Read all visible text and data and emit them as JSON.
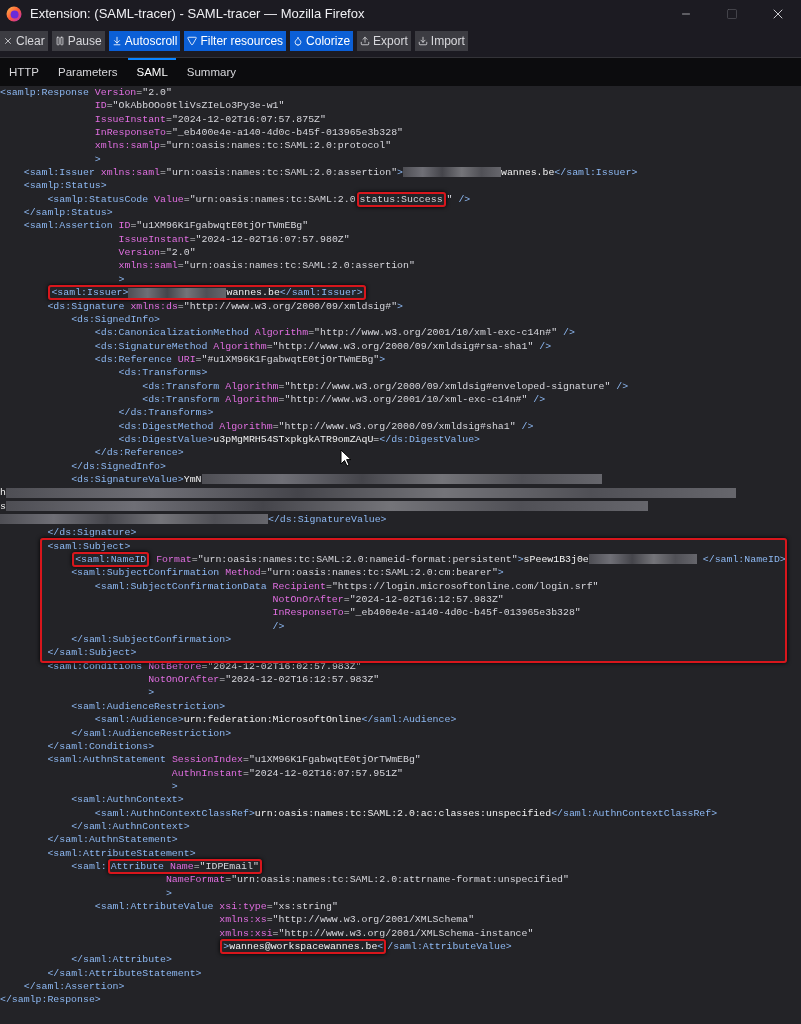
{
  "window": {
    "title": "Extension: (SAML-tracer) - SAML-tracer — Mozilla Firefox",
    "controls": [
      {
        "kind": "minimize",
        "disabled": false
      },
      {
        "kind": "maximize",
        "disabled": true
      },
      {
        "kind": "close",
        "disabled": false
      }
    ]
  },
  "toolbar": [
    {
      "kind": "clear",
      "label": "Clear",
      "on": false
    },
    {
      "kind": "pause",
      "label": "Pause",
      "on": false
    },
    {
      "kind": "autoscroll",
      "label": "Autoscroll",
      "on": true
    },
    {
      "kind": "filter",
      "label": "Filter resources",
      "on": true
    },
    {
      "kind": "colorize",
      "label": "Colorize",
      "on": true
    },
    {
      "kind": "export",
      "label": "Export",
      "on": false
    },
    {
      "kind": "import",
      "label": "Import",
      "on": false
    }
  ],
  "tabs": [
    {
      "label": "HTTP",
      "selected": false
    },
    {
      "label": "Parameters",
      "selected": false
    },
    {
      "label": "SAML",
      "selected": true
    },
    {
      "label": "Summary",
      "selected": false
    }
  ],
  "code": {
    "lines": [
      {
        "kind": "element",
        "tokens": [
          {
            "kind": "tag",
            "text": "<samlp:Response"
          },
          {
            "kind": "attr",
            "text": " Version"
          },
          {
            "kind": "value",
            "text": "=\"2.0\""
          }
        ],
        "continuation_lines": [
          {
            "tokens": [
              {
                "kind": "attr",
                "text": "ID"
              },
              {
                "kind": "value",
                "text": "=\"OkAbbOOo9tliVsZIeLo3Py3e-w1\""
              }
            ]
          },
          {
            "tokens": [
              {
                "kind": "attr",
                "text": "IssueInstant"
              },
              {
                "kind": "value",
                "text": "=\"2024-12-02T16:07:57.875Z\""
              }
            ]
          },
          {
            "tokens": [
              {
                "kind": "attr",
                "text": "InResponseTo"
              },
              {
                "kind": "value",
                "text": "=\"_eb400e4e-a140-4d0c-b45f-013965e3b328\""
              }
            ]
          },
          {
            "tokens": [
              {
                "kind": "attr",
                "text": "xmlns:samlp"
              },
              {
                "kind": "value",
                "text": "=\"urn:oasis:names:tc:SAML:2.0:protocol\""
              }
            ]
          },
          {
            "tokens": [
              {
                "kind": "tag",
                "text": ">"
              }
            ]
          }
        ],
        "children": [
          {
            "kind": "element",
            "tokens": [
              {
                "kind": "tag",
                "text": "<saml:Issuer"
              },
              {
                "kind": "attr",
                "text": " xmlns:saml"
              },
              {
                "kind": "value",
                "text": "=\"urn:oasis:names:tc:SAML:2.0:assertion\""
              },
              {
                "kind": "tag",
                "text": ">"
              },
              {
                "kind": "redacted-short"
              },
              {
                "kind": "text",
                "text": "wannes.be"
              },
              {
                "kind": "tag",
                "text": "</saml:Issuer>"
              }
            ]
          },
          {
            "kind": "element",
            "tokens": [
              {
                "kind": "tag",
                "text": "<samlp:Status>"
              }
            ],
            "children": [
              {
                "kind": "element",
                "tokens": [
                  {
                    "kind": "tag",
                    "text": "<samlp:StatusCode"
                  },
                  {
                    "kind": "attr",
                    "text": " Value"
                  },
                  {
                    "kind": "value",
                    "text": "=\"urn:oasis:names:tc:SAML:2.0"
                  },
                  {
                    "kind": "boxed",
                    "tokens": [
                      {
                        "kind": "value",
                        "text": "status:Success"
                      }
                    ]
                  },
                  {
                    "kind": "value",
                    "text": "\""
                  },
                  {
                    "kind": "tag",
                    "text": " />"
                  }
                ]
              }
            ]
          },
          {
            "kind": "element",
            "tokens": [
              {
                "kind": "tag",
                "text": "</samlp:Status>"
              }
            ]
          },
          {
            "kind": "element",
            "tokens": [
              {
                "kind": "tag",
                "text": "<saml:Assertion"
              },
              {
                "kind": "attr",
                "text": " ID"
              },
              {
                "kind": "value",
                "text": "=\"u1XM96K1FgabwqtE0tjOrTWmEBg\""
              }
            ],
            "continuation_lines": [
              {
                "tokens": [
                  {
                    "kind": "attr",
                    "text": "IssueInstant"
                  },
                  {
                    "kind": "value",
                    "text": "=\"2024-12-02T16:07:57.980Z\""
                  }
                ]
              },
              {
                "tokens": [
                  {
                    "kind": "attr",
                    "text": "Version"
                  },
                  {
                    "kind": "value",
                    "text": "=\"2.0\""
                  }
                ]
              },
              {
                "tokens": [
                  {
                    "kind": "attr",
                    "text": "xmlns:saml"
                  },
                  {
                    "kind": "value",
                    "text": "=\"urn:oasis:names:tc:SAML:2.0:assertion\""
                  }
                ]
              },
              {
                "tokens": [
                  {
                    "kind": "tag",
                    "text": ">"
                  }
                ]
              }
            ],
            "children": [
              {
                "kind": "element",
                "tokens": [
                  {
                    "kind": "boxed",
                    "tokens": [
                      {
                        "kind": "tag",
                        "text": "<saml:Issuer>"
                      },
                      {
                        "kind": "redacted-short"
                      },
                      {
                        "kind": "text",
                        "text": "wannes.be"
                      },
                      {
                        "kind": "tag",
                        "text": "</saml:Issuer>"
                      }
                    ]
                  }
                ]
              },
              {
                "kind": "element",
                "tokens": [
                  {
                    "kind": "tag",
                    "text": "<ds:Signature"
                  },
                  {
                    "kind": "attr",
                    "text": " xmlns:ds"
                  },
                  {
                    "kind": "value",
                    "text": "=\"http://www.w3.org/2000/09/xmldsig#\""
                  },
                  {
                    "kind": "tag",
                    "text": ">"
                  }
                ],
                "children": [
                  {
                    "kind": "element",
                    "tokens": [
                      {
                        "kind": "tag",
                        "text": "<ds:SignedInfo>"
                      }
                    ],
                    "children": [
                      {
                        "kind": "element",
                        "tokens": [
                          {
                            "kind": "tag",
                            "text": "<ds:CanonicalizationMethod"
                          },
                          {
                            "kind": "attr",
                            "text": " Algorithm"
                          },
                          {
                            "kind": "value",
                            "text": "=\"http://www.w3.org/2001/10/xml-exc-c14n#\""
                          },
                          {
                            "kind": "tag",
                            "text": " />"
                          }
                        ]
                      },
                      {
                        "kind": "element",
                        "tokens": [
                          {
                            "kind": "tag",
                            "text": "<ds:SignatureMethod"
                          },
                          {
                            "kind": "attr",
                            "text": " Algorithm"
                          },
                          {
                            "kind": "value",
                            "text": "=\"http://www.w3.org/2000/09/xmldsig#rsa-sha1\""
                          },
                          {
                            "kind": "tag",
                            "text": " />"
                          }
                        ]
                      },
                      {
                        "kind": "element",
                        "tokens": [
                          {
                            "kind": "tag",
                            "text": "<ds:Reference"
                          },
                          {
                            "kind": "attr",
                            "text": " URI"
                          },
                          {
                            "kind": "value",
                            "text": "=\"#u1XM96K1FgabwqtE0tjOrTWmEBg\""
                          },
                          {
                            "kind": "tag",
                            "text": ">"
                          }
                        ],
                        "children": [
                          {
                            "kind": "element",
                            "tokens": [
                              {
                                "kind": "tag",
                                "text": "<ds:Transforms>"
                              }
                            ],
                            "children": [
                              {
                                "kind": "element",
                                "tokens": [
                                  {
                                    "kind": "tag",
                                    "text": "<ds:Transform"
                                  },
                                  {
                                    "kind": "attr",
                                    "text": " Algorithm"
                                  },
                                  {
                                    "kind": "value",
                                    "text": "=\"http://www.w3.org/2000/09/xmldsig#enveloped-signature\""
                                  },
                                  {
                                    "kind": "tag",
                                    "text": " />"
                                  }
                                ]
                              },
                              {
                                "kind": "element",
                                "tokens": [
                                  {
                                    "kind": "tag",
                                    "text": "<ds:Transform"
                                  },
                                  {
                                    "kind": "attr",
                                    "text": " Algorithm"
                                  },
                                  {
                                    "kind": "value",
                                    "text": "=\"http://www.w3.org/2001/10/xml-exc-c14n#\""
                                  },
                                  {
                                    "kind": "tag",
                                    "text": " />"
                                  }
                                ]
                              }
                            ]
                          },
                          {
                            "kind": "element",
                            "tokens": [
                              {
                                "kind": "tag",
                                "text": "</ds:Transforms>"
                              }
                            ]
                          },
                          {
                            "kind": "element",
                            "tokens": [
                              {
                                "kind": "tag",
                                "text": "<ds:DigestMethod"
                              },
                              {
                                "kind": "attr",
                                "text": " Algorithm"
                              },
                              {
                                "kind": "value",
                                "text": "=\"http://www.w3.org/2000/09/xmldsig#sha1\""
                              },
                              {
                                "kind": "tag",
                                "text": " />"
                              }
                            ]
                          },
                          {
                            "kind": "element",
                            "tokens": [
                              {
                                "kind": "tag",
                                "text": "<ds:DigestValue>"
                              },
                              {
                                "kind": "text",
                                "text": "u3pMgMRH54STxpkgkATR9omZAqU="
                              },
                              {
                                "kind": "tag",
                                "text": "</ds:DigestValue>"
                              }
                            ]
                          }
                        ]
                      },
                      {
                        "kind": "element",
                        "tokens": [
                          {
                            "kind": "tag",
                            "text": "</ds:Reference>"
                          }
                        ]
                      }
                    ]
                  },
                  {
                    "kind": "element",
                    "tokens": [
                      {
                        "kind": "tag",
                        "text": "</ds:SignedInfo>"
                      }
                    ]
                  },
                  {
                    "kind": "element",
                    "tokens": [
                      {
                        "kind": "tag",
                        "text": "<ds:SignatureValue>"
                      },
                      {
                        "kind": "text",
                        "text": "YmN"
                      },
                      {
                        "kind": "redacted-wide"
                      }
                    ]
                  },
                  {
                    "kind": "wrapped",
                    "tokens": [
                      {
                        "kind": "text",
                        "text": "h"
                      },
                      {
                        "kind": "redacted-full"
                      }
                    ]
                  },
                  {
                    "kind": "wrapped",
                    "tokens": [
                      {
                        "kind": "text",
                        "text": "s"
                      },
                      {
                        "kind": "redacted-most"
                      }
                    ]
                  },
                  {
                    "kind": "wrapped",
                    "tokens": [
                      {
                        "kind": "redacted-long"
                      },
                      {
                        "kind": "tag",
                        "text": "</ds:SignatureValue>"
                      }
                    ]
                  }
                ]
              },
              {
                "kind": "element",
                "tokens": [
                  {
                    "kind": "tag",
                    "text": "</ds:Signature>"
                  }
                ]
              },
              {
                "kind": "boxed-block",
                "lines": [
                  {
                    "kind": "element",
                    "tokens": [
                      {
                        "kind": "tag",
                        "text": "<saml:Subject>"
                      }
                    ],
                    "children": [
                      {
                        "kind": "element",
                        "tokens": [
                          {
                            "kind": "boxed",
                            "tokens": [
                              {
                                "kind": "tag",
                                "text": "<saml:NameID"
                              }
                            ]
                          },
                          {
                            "kind": "attr",
                            "text": " Format"
                          },
                          {
                            "kind": "value",
                            "text": "=\"urn:oasis:names:tc:SAML:2.0:nameid-format:persistent\""
                          },
                          {
                            "kind": "tag",
                            "text": ">"
                          },
                          {
                            "kind": "text",
                            "text": "sPeew1B3j0e"
                          },
                          {
                            "kind": "redacted-medium"
                          },
                          {
                            "kind": "tag",
                            "text": "</saml:NameID>"
                          }
                        ]
                      },
                      {
                        "kind": "element",
                        "tokens": [
                          {
                            "kind": "tag",
                            "text": "<saml:SubjectConfirmation"
                          },
                          {
                            "kind": "attr",
                            "text": " Method"
                          },
                          {
                            "kind": "value",
                            "text": "=\"urn:oasis:names:tc:SAML:2.0:cm:bearer\""
                          },
                          {
                            "kind": "tag",
                            "text": ">"
                          }
                        ],
                        "children": [
                          {
                            "kind": "element",
                            "tokens": [
                              {
                                "kind": "tag",
                                "text": "<saml:SubjectConfirmationData"
                              },
                              {
                                "kind": "attr",
                                "text": " Recipient"
                              },
                              {
                                "kind": "value",
                                "text": "=\"https://login.microsoftonline.com/login.srf\""
                              }
                            ],
                            "continuation_lines": [
                              {
                                "tokens": [
                                  {
                                    "kind": "attr",
                                    "text": "NotOnOrAfter"
                                  },
                                  {
                                    "kind": "value",
                                    "text": "=\"2024-12-02T16:12:57.983Z\""
                                  }
                                ]
                              },
                              {
                                "tokens": [
                                  {
                                    "kind": "attr",
                                    "text": "InResponseTo"
                                  },
                                  {
                                    "kind": "value",
                                    "text": "=\"_eb400e4e-a140-4d0c-b45f-013965e3b328\""
                                  }
                                ]
                              },
                              {
                                "tokens": [
                                  {
                                    "kind": "tag",
                                    "text": "/>"
                                  }
                                ]
                              }
                            ]
                          }
                        ]
                      },
                      {
                        "kind": "element",
                        "tokens": [
                          {
                            "kind": "tag",
                            "text": "</saml:SubjectConfirmation>"
                          }
                        ]
                      }
                    ]
                  },
                  {
                    "kind": "element",
                    "tokens": [
                      {
                        "kind": "tag",
                        "text": "</saml:Subject>"
                      }
                    ]
                  }
                ]
              },
              {
                "kind": "element",
                "tokens": [
                  {
                    "kind": "tag",
                    "text": "<saml:Conditions"
                  },
                  {
                    "kind": "attr",
                    "text": " NotBefore"
                  },
                  {
                    "kind": "value",
                    "text": "=\"2024-12-02T16:02:57.983Z\""
                  }
                ],
                "continuation_lines": [
                  {
                    "tokens": [
                      {
                        "kind": "attr",
                        "text": "NotOnOrAfter"
                      },
                      {
                        "kind": "value",
                        "text": "=\"2024-12-02T16:12:57.983Z\""
                      }
                    ]
                  },
                  {
                    "tokens": [
                      {
                        "kind": "tag",
                        "text": ">"
                      }
                    ]
                  }
                ],
                "children": [
                  {
                    "kind": "element",
                    "tokens": [
                      {
                        "kind": "tag",
                        "text": "<saml:AudienceRestriction>"
                      }
                    ],
                    "children": [
                      {
                        "kind": "element",
                        "tokens": [
                          {
                            "kind": "tag",
                            "text": "<saml:Audience>"
                          },
                          {
                            "kind": "text",
                            "text": "urn:federation:MicrosoftOnline"
                          },
                          {
                            "kind": "tag",
                            "text": "</saml:Audience>"
                          }
                        ]
                      }
                    ]
                  },
                  {
                    "kind": "element",
                    "tokens": [
                      {
                        "kind": "tag",
                        "text": "</saml:AudienceRestriction>"
                      }
                    ]
                  }
                ]
              },
              {
                "kind": "element",
                "tokens": [
                  {
                    "kind": "tag",
                    "text": "</saml:Conditions>"
                  }
                ]
              },
              {
                "kind": "element",
                "tokens": [
                  {
                    "kind": "tag",
                    "text": "<saml:AuthnStatement"
                  },
                  {
                    "kind": "attr",
                    "text": " SessionIndex"
                  },
                  {
                    "kind": "value",
                    "text": "=\"u1XM96K1FgabwqtE0tjOrTWmEBg\""
                  }
                ],
                "continuation_lines": [
                  {
                    "tokens": [
                      {
                        "kind": "attr",
                        "text": "AuthnInstant"
                      },
                      {
                        "kind": "value",
                        "text": "=\"2024-12-02T16:07:57.951Z\""
                      }
                    ]
                  },
                  {
                    "tokens": [
                      {
                        "kind": "tag",
                        "text": ">"
                      }
                    ]
                  }
                ],
                "children": [
                  {
                    "kind": "element",
                    "tokens": [
                      {
                        "kind": "tag",
                        "text": "<saml:AuthnContext>"
                      }
                    ],
                    "children": [
                      {
                        "kind": "element",
                        "tokens": [
                          {
                            "kind": "tag",
                            "text": "<saml:AuthnContextClassRef>"
                          },
                          {
                            "kind": "text",
                            "text": "urn:oasis:names:tc:SAML:2.0:ac:classes:unspecified"
                          },
                          {
                            "kind": "tag",
                            "text": "</saml:AuthnContextClassRef>"
                          }
                        ]
                      }
                    ]
                  },
                  {
                    "kind": "element",
                    "tokens": [
                      {
                        "kind": "tag",
                        "text": "</saml:AuthnContext>"
                      }
                    ]
                  }
                ]
              },
              {
                "kind": "element",
                "tokens": [
                  {
                    "kind": "tag",
                    "text": "</saml:AuthnStatement>"
                  }
                ]
              },
              {
                "kind": "element",
                "tokens": [
                  {
                    "kind": "tag",
                    "text": "<saml:AttributeStatement>"
                  }
                ],
                "children": [
                  {
                    "kind": "element",
                    "tokens": [
                      {
                        "kind": "tag",
                        "text": "<saml:"
                      },
                      {
                        "kind": "boxed",
                        "tokens": [
                          {
                            "kind": "tag",
                            "text": "Attribute"
                          },
                          {
                            "kind": "attr",
                            "text": " Name"
                          },
                          {
                            "kind": "value",
                            "text": "=\"IDPEmail\""
                          }
                        ]
                      }
                    ],
                    "continuation_lines": [
                      {
                        "tokens": [
                          {
                            "kind": "attr",
                            "text": "NameFormat"
                          },
                          {
                            "kind": "value",
                            "text": "=\"urn:oasis:names:tc:SAML:2.0:attrname-format:unspecified\""
                          }
                        ]
                      },
                      {
                        "tokens": [
                          {
                            "kind": "tag",
                            "text": ">"
                          }
                        ]
                      }
                    ],
                    "children": [
                      {
                        "kind": "element",
                        "tokens": [
                          {
                            "kind": "tag",
                            "text": "<saml:AttributeValue"
                          },
                          {
                            "kind": "attr",
                            "text": " xsi:type"
                          },
                          {
                            "kind": "value",
                            "text": "=\"xs:string\""
                          }
                        ],
                        "continuation_lines": [
                          {
                            "tokens": [
                              {
                                "kind": "attr",
                                "text": "xmlns:xs"
                              },
                              {
                                "kind": "value",
                                "text": "=\"http://www.w3.org/2001/XMLSchema\""
                              }
                            ]
                          },
                          {
                            "tokens": [
                              {
                                "kind": "attr",
                                "text": "xmlns:xsi"
                              },
                              {
                                "kind": "value",
                                "text": "=\"http://www.w3.org/2001/XMLSchema-instance\""
                              }
                            ]
                          },
                          {
                            "tokens": [
                              {
                                "kind": "boxed",
                                "tokens": [
                                  {
                                    "kind": "tag",
                                    "text": ">"
                                  },
                                  {
                                    "kind": "text",
                                    "text": "wannes@workspacewannes.be"
                                  },
                                  {
                                    "kind": "tag",
                                    "text": "<"
                                  }
                                ]
                              },
                              {
                                "kind": "tag",
                                "text": "/saml:AttributeValue>"
                              }
                            ]
                          }
                        ]
                      }
                    ]
                  },
                  {
                    "kind": "element",
                    "tokens": [
                      {
                        "kind": "tag",
                        "text": "</saml:Attribute>"
                      }
                    ]
                  }
                ]
              },
              {
                "kind": "element",
                "tokens": [
                  {
                    "kind": "tag",
                    "text": "</saml:AttributeStatement>"
                  }
                ]
              }
            ]
          },
          {
            "kind": "element",
            "tokens": [
              {
                "kind": "tag",
                "text": "</saml:Assertion>"
              }
            ]
          }
        ]
      },
      {
        "kind": "element",
        "tokens": [
          {
            "kind": "tag",
            "text": "</samlp:Response>"
          }
        ]
      }
    ]
  }
}
